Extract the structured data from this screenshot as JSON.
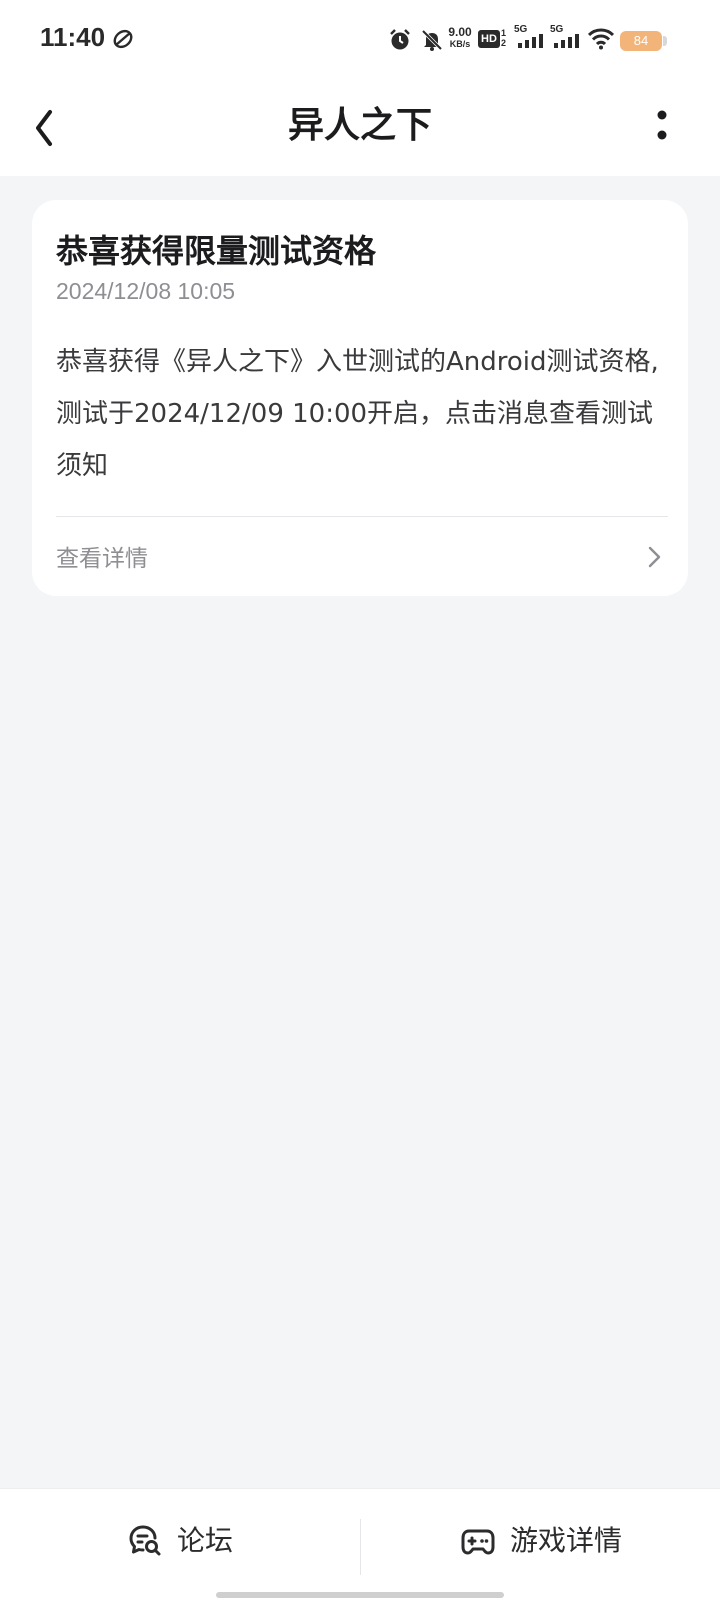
{
  "status_bar": {
    "time": "11:40",
    "network_speed_value": "9.00",
    "network_speed_unit": "KB/s",
    "hd_label": "HD",
    "sim1_label": "5G",
    "sim2_label": "5G",
    "battery_level": "84",
    "battery_color": "#f3b47a"
  },
  "header": {
    "title": "异人之下"
  },
  "message": {
    "title": "恭喜获得限量测试资格",
    "timestamp": "2024/12/08 10:05",
    "body": "恭喜获得《异人之下》入世测试的Android测试资格,测试于2024/12/09 10:00开启，点击消息查看测试须知",
    "link_label": "查看详情"
  },
  "bottom_bar": {
    "forum_label": "论坛",
    "game_details_label": "游戏详情"
  },
  "icons": {
    "back": "back-arrow-icon",
    "more": "more-vertical-icon",
    "chevron": "chevron-right-icon",
    "forum": "forum-chat-icon",
    "game": "gamepad-icon"
  },
  "colors": {
    "page_background": "#f4f5f7",
    "card_background": "#ffffff",
    "secondary_text": "#8e8e93"
  }
}
